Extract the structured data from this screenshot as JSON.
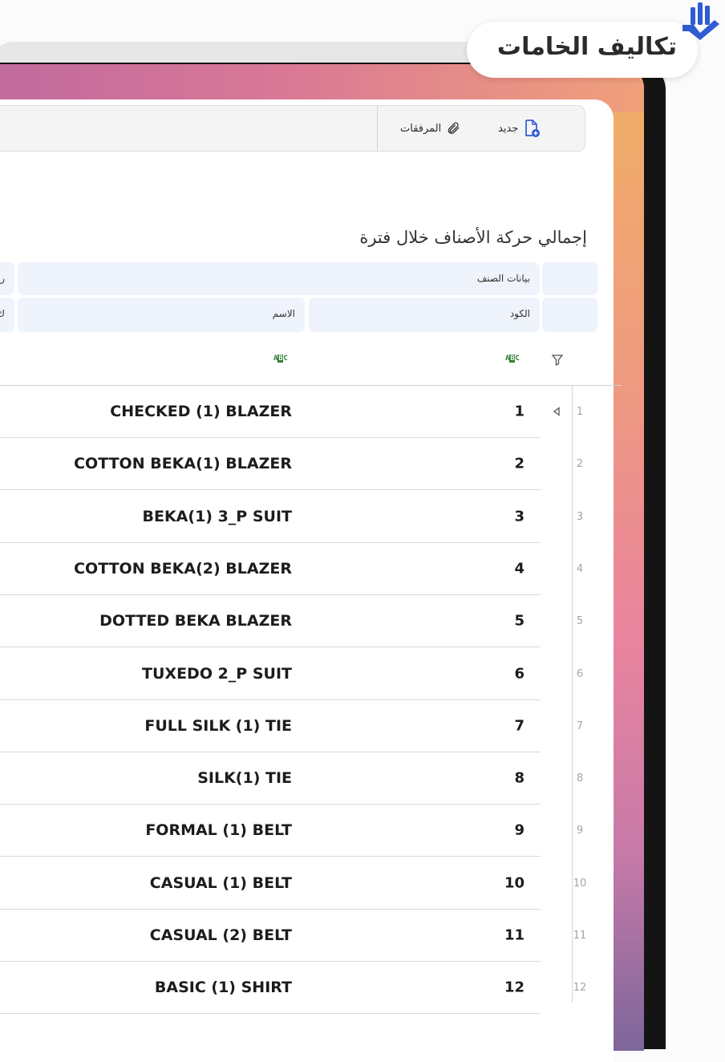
{
  "badge": {
    "label": "تكاليف الخامات"
  },
  "toolbar": {
    "new_label": "جديد",
    "attachments_label": "المرفقات"
  },
  "report": {
    "title": "إجمالي حركة الأصناف خلال فترة"
  },
  "table": {
    "group_header": "بيانات الصنف",
    "group_header_next": "رد",
    "columns": {
      "code": "الكود",
      "name": "الاسم",
      "next": "ك"
    },
    "type_badge": "ABC",
    "rows": [
      {
        "num": "1",
        "code": "1",
        "name": "CHECKED (1) BLAZER"
      },
      {
        "num": "2",
        "code": "2",
        "name": "COTTON BEKA(1) BLAZER"
      },
      {
        "num": "3",
        "code": "3",
        "name": "BEKA(1)  3_P SUIT"
      },
      {
        "num": "4",
        "code": "4",
        "name": "COTTON BEKA(2) BLAZER"
      },
      {
        "num": "5",
        "code": "5",
        "name": "DOTTED BEKA BLAZER"
      },
      {
        "num": "6",
        "code": "6",
        "name": "TUXEDO 2_P SUIT"
      },
      {
        "num": "7",
        "code": "7",
        "name": "FULL SILK (1) TIE"
      },
      {
        "num": "8",
        "code": "8",
        "name": "SILK(1) TIE"
      },
      {
        "num": "9",
        "code": "9",
        "name": "FORMAL (1) BELT"
      },
      {
        "num": "10",
        "code": "10",
        "name": "CASUAL (1) BELT"
      },
      {
        "num": "11",
        "code": "11",
        "name": "CASUAL (2) BELT"
      },
      {
        "num": "12",
        "code": "12",
        "name": "BASIC (1)  SHIRT"
      }
    ]
  },
  "colors": {
    "accent": "#2f5bd3",
    "header_bg": "#eef3fc",
    "abc_green": "#2e7d32"
  },
  "icons": {
    "new": "file-plus-icon",
    "attach": "paperclip-icon",
    "filter": "filter-icon",
    "current_row": "row-pointer-icon",
    "brand": "brand-logo-icon"
  }
}
